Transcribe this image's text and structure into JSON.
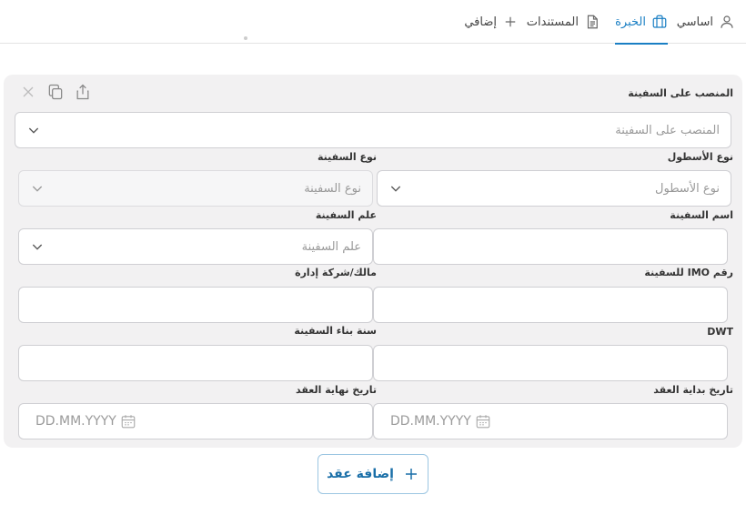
{
  "tabs": [
    {
      "label": "اساسي",
      "icon": "user-icon",
      "active": false
    },
    {
      "label": "الخبرة",
      "icon": "briefcase-icon",
      "active": true
    },
    {
      "label": "المستندات",
      "icon": "document-icon",
      "active": false
    },
    {
      "label": "إضافي",
      "icon": "plus-icon",
      "active": false
    }
  ],
  "form": {
    "position": {
      "label": "المنصب على السفينة",
      "placeholder": "المنصب على السفينة"
    },
    "fleet_type": {
      "label": "نوع الأسطول",
      "placeholder": "نوع الأسطول"
    },
    "vessel_type": {
      "label": "نوع السفينة",
      "placeholder": "نوع السفينة"
    },
    "vessel_name": {
      "label": "اسم السفينة",
      "value": ""
    },
    "vessel_flag": {
      "label": "علم السفينة",
      "placeholder": "علم السفينة"
    },
    "imo_number": {
      "label": "رقم IMO للسفينة",
      "value": ""
    },
    "owner_company": {
      "label": "مالك/شركة إدارة",
      "value": ""
    },
    "dwt": {
      "label": "DWT",
      "value": ""
    },
    "build_year": {
      "label": "سنة بناء السفينة",
      "value": ""
    },
    "contract_start": {
      "label": "تاريخ بداية العقد",
      "placeholder": "DD.MM.YYYY"
    },
    "contract_end": {
      "label": "تاريخ نهاية العقد",
      "placeholder": "DD.MM.YYYY"
    }
  },
  "card_actions": [
    "share-icon",
    "copy-icon",
    "close-icon"
  ],
  "add_contract": {
    "label": "إضافة عقد",
    "icon": "plus-icon"
  },
  "colors": {
    "accent": "#1a7fc4",
    "card_bg": "#f2f1f2",
    "border": "#cfcfd3"
  }
}
